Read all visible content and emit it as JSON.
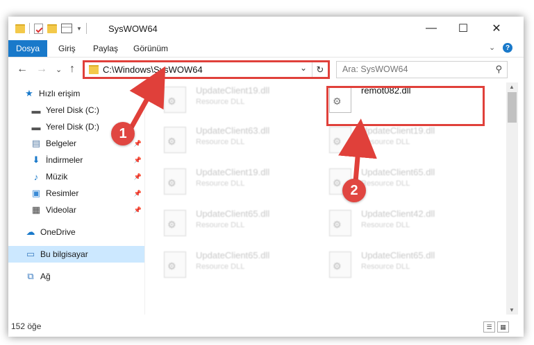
{
  "window": {
    "title": "SysWOW64",
    "minimize_glyph": "—",
    "maximize_glyph": "☐",
    "close_glyph": "✕"
  },
  "ribbon": {
    "tabs": [
      "Dosya",
      "Giriş",
      "Paylaş",
      "Görünüm"
    ],
    "expand_glyph": "⌄",
    "help_glyph": "?"
  },
  "address": {
    "path": "C:\\Windows\\SysWOW64",
    "dropdown_glyph": "⌄",
    "refresh_glyph": "↻"
  },
  "search": {
    "placeholder": "Ara: SysWOW64",
    "icon": "search-icon"
  },
  "nav_buttons": {
    "back": "←",
    "forward": "→",
    "recent": "⌄",
    "up": "↑"
  },
  "sidebar": {
    "items": [
      {
        "label": "Hızlı erişim",
        "icon": "star-icon",
        "pinned": false
      },
      {
        "label": "Yerel Disk (C:)",
        "icon": "drive-icon",
        "pinned": false
      },
      {
        "label": "Yerel Disk (D:)",
        "icon": "drive-icon",
        "pinned": false
      },
      {
        "label": "Belgeler",
        "icon": "documents-icon",
        "pinned": true
      },
      {
        "label": "İndirmeler",
        "icon": "download-icon",
        "pinned": true
      },
      {
        "label": "Müzik",
        "icon": "music-icon",
        "pinned": true
      },
      {
        "label": "Resimler",
        "icon": "pictures-icon",
        "pinned": true
      },
      {
        "label": "Videolar",
        "icon": "video-icon",
        "pinned": true
      },
      {
        "label": "OneDrive",
        "icon": "cloud-icon",
        "pinned": false
      },
      {
        "label": "Bu bilgisayar",
        "icon": "computer-icon",
        "pinned": false,
        "selected": true
      },
      {
        "label": "Ağ",
        "icon": "network-icon",
        "pinned": false
      }
    ]
  },
  "files": [
    {
      "name": "UpdateClient19.dll",
      "type": "Resource DLL",
      "highlighted": false
    },
    {
      "name": "remot082.dll",
      "type": "",
      "highlighted": true
    },
    {
      "name": "UpdateClient63.dll",
      "type": "Resource DLL",
      "highlighted": false
    },
    {
      "name": "UpdateClient19.dll",
      "type": "Resource DLL",
      "highlighted": false
    },
    {
      "name": "UpdateClient19.dll",
      "type": "Resource DLL",
      "highlighted": false
    },
    {
      "name": "UpdateClient65.dll",
      "type": "Resource DLL",
      "highlighted": false
    },
    {
      "name": "UpdateClient65.dll",
      "type": "Resource DLL",
      "highlighted": false
    },
    {
      "name": "UpdateClient42.dll",
      "type": "Resource DLL",
      "highlighted": false
    },
    {
      "name": "UpdateClient65.dll",
      "type": "Resource DLL",
      "highlighted": false
    },
    {
      "name": "UpdateClient65.dll",
      "type": "Resource DLL",
      "highlighted": false
    }
  ],
  "status": {
    "item_count": "152 öğe"
  },
  "annotations": {
    "step1": "1",
    "step2": "2",
    "color": "#e0403a"
  },
  "colors": {
    "file_tab": "#1979ca",
    "selected_nav": "#cce8ff"
  }
}
